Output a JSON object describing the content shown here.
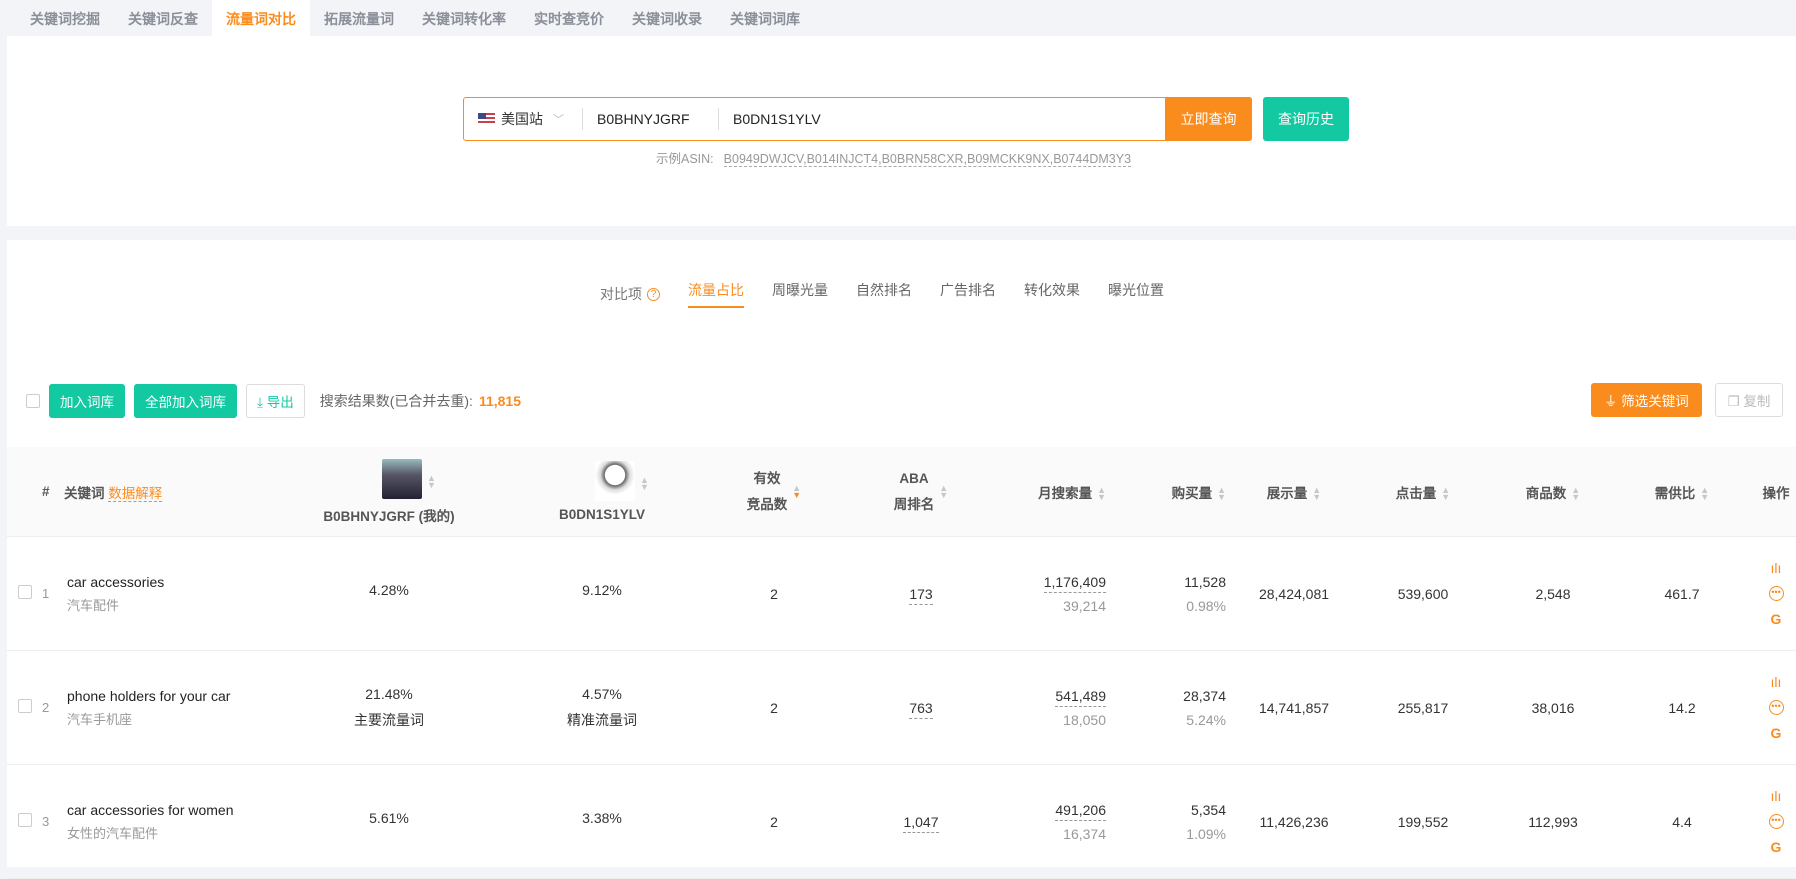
{
  "nav": {
    "tabs": [
      "关键词挖掘",
      "关键词反查",
      "流量词对比",
      "拓展流量词",
      "关键词转化率",
      "实时查竞价",
      "关键词收录",
      "关键词词库"
    ],
    "active": 2
  },
  "search": {
    "site": "美国站",
    "asin1": "B0BHNYJGRF",
    "asin2": "B0DN1S1YLV",
    "query_label": "立即查询",
    "history_label": "查询历史",
    "example_label": "示例ASIN:",
    "example_value": "B0949DWJCV,B014INJCT4,B0BRN58CXR,B09MCKK9NX,B0744DM3Y3"
  },
  "compare": {
    "label": "对比项",
    "tabs": [
      "流量占比",
      "周曝光量",
      "自然排名",
      "广告排名",
      "转化效果",
      "曝光位置"
    ],
    "active": 0
  },
  "toolbar": {
    "add": "加入词库",
    "add_all": "全部加入词库",
    "export": "导出",
    "count_label": "搜索结果数(已合并去重):",
    "count": "11,815",
    "filter": "筛选关键词",
    "copy": "复制"
  },
  "colors": {
    "accent": "#fa8c1e",
    "green": "#13c9a1"
  },
  "table": {
    "headers": {
      "num": "#",
      "keyword": "关键词",
      "explain": "数据解释",
      "asin1": "B0BHNYJGRF (我的)",
      "asin2": "B0DN1S1YLV",
      "comp1": "有效",
      "comp2": "竞品数",
      "aba1": "ABA",
      "aba2": "周排名",
      "monthly": "月搜索量",
      "purchase": "购买量",
      "impr": "展示量",
      "clicks": "点击量",
      "products": "商品数",
      "ratio": "需供比",
      "ops": "操作"
    },
    "rows": [
      {
        "n": "1",
        "kw": "car accessories",
        "zh": "汽车配件",
        "a1": "4.28%",
        "a1tag": "",
        "a2": "9.12%",
        "a2tag": "",
        "comp": "2",
        "aba": "173",
        "monthly": "1,176,409",
        "monthly_sub": "39,214",
        "purchase": "11,528",
        "purchase_rate": "0.98%",
        "impr": "28,424,081",
        "clicks": "539,600",
        "products": "2,548",
        "ratio": "461.7"
      },
      {
        "n": "2",
        "kw": "phone holders for your car",
        "zh": "汽车手机座",
        "a1": "21.48%",
        "a1tag": "主要流量词",
        "a2": "4.57%",
        "a2tag": "精准流量词",
        "comp": "2",
        "aba": "763",
        "monthly": "541,489",
        "monthly_sub": "18,050",
        "purchase": "28,374",
        "purchase_rate": "5.24%",
        "impr": "14,741,857",
        "clicks": "255,817",
        "products": "38,016",
        "ratio": "14.2"
      },
      {
        "n": "3",
        "kw": "car accessories for women",
        "zh": "女性的汽车配件",
        "a1": "5.61%",
        "a1tag": "",
        "a2": "3.38%",
        "a2tag": "",
        "comp": "2",
        "aba": "1,047",
        "monthly": "491,206",
        "monthly_sub": "16,374",
        "purchase": "5,354",
        "purchase_rate": "1.09%",
        "impr": "11,426,236",
        "clicks": "199,552",
        "products": "112,993",
        "ratio": "4.4"
      }
    ]
  }
}
